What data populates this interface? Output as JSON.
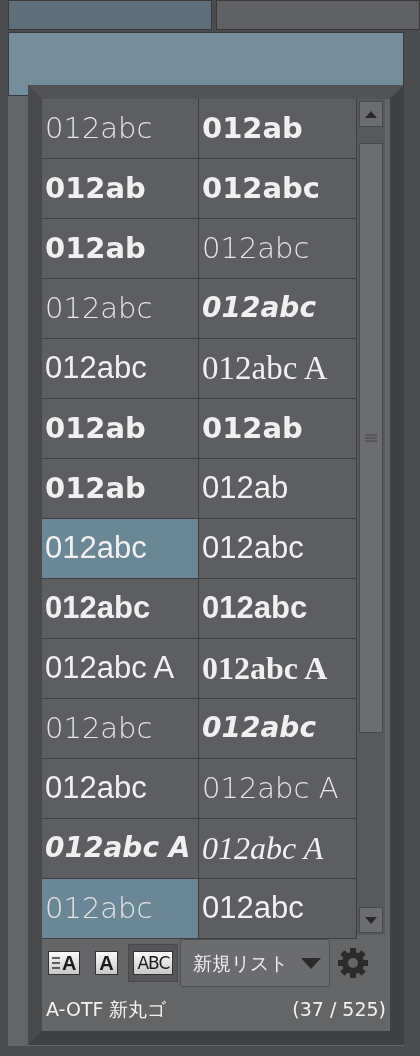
{
  "font_list": {
    "cells": [
      {
        "sample": "012abc",
        "kind": "light",
        "selected": false
      },
      {
        "sample": "012ab",
        "kind": "heavy",
        "selected": false
      },
      {
        "sample": "012ab",
        "kind": "heavy",
        "selected": false
      },
      {
        "sample": "012abc",
        "kind": "heavy",
        "selected": false
      },
      {
        "sample": "012ab",
        "kind": "heavy",
        "selected": false
      },
      {
        "sample": "012abc",
        "kind": "light",
        "selected": false
      },
      {
        "sample": "012abc",
        "kind": "light",
        "selected": false
      },
      {
        "sample": "012abc",
        "kind": "heavy-italic",
        "selected": false
      },
      {
        "sample": "012abc",
        "kind": "sans",
        "selected": false
      },
      {
        "sample": "012abc A",
        "kind": "serif",
        "selected": false
      },
      {
        "sample": "012ab",
        "kind": "heavy",
        "selected": false
      },
      {
        "sample": "012ab",
        "kind": "heavy",
        "selected": false
      },
      {
        "sample": "012ab",
        "kind": "heavy",
        "selected": false
      },
      {
        "sample": "012ab",
        "kind": "sans",
        "selected": false
      },
      {
        "sample": "012abc",
        "kind": "sans",
        "selected": true
      },
      {
        "sample": "012abc",
        "kind": "sans",
        "selected": false
      },
      {
        "sample": "012abc",
        "kind": "bold",
        "selected": false
      },
      {
        "sample": "012abc",
        "kind": "bold",
        "selected": false
      },
      {
        "sample": "012abc A",
        "kind": "sans",
        "selected": false
      },
      {
        "sample": "012abc A",
        "kind": "serif-bold",
        "selected": false
      },
      {
        "sample": "012abc",
        "kind": "light",
        "selected": false
      },
      {
        "sample": "012abc",
        "kind": "heavy-italic",
        "selected": false
      },
      {
        "sample": "012abc",
        "kind": "sans",
        "selected": false
      },
      {
        "sample": "012abc A",
        "kind": "light",
        "selected": false
      },
      {
        "sample": "012abc A",
        "kind": "heavy-italic",
        "selected": false
      },
      {
        "sample": "012abc A",
        "kind": "italic",
        "selected": false
      },
      {
        "sample": "012abc",
        "kind": "light",
        "selected": true
      },
      {
        "sample": "012abc",
        "kind": "sans",
        "selected": false
      }
    ]
  },
  "toolbar": {
    "view_buttons": [
      {
        "label": "A",
        "kind": "list",
        "selected": false
      },
      {
        "label": "A",
        "kind": "preview",
        "selected": false
      },
      {
        "label": "ABC",
        "kind": "text",
        "selected": true
      }
    ],
    "list_dropdown": {
      "value": "新規リスト"
    }
  },
  "status": {
    "font_name": "A-OTF 新丸ゴ",
    "count": "(37 / 525)"
  }
}
